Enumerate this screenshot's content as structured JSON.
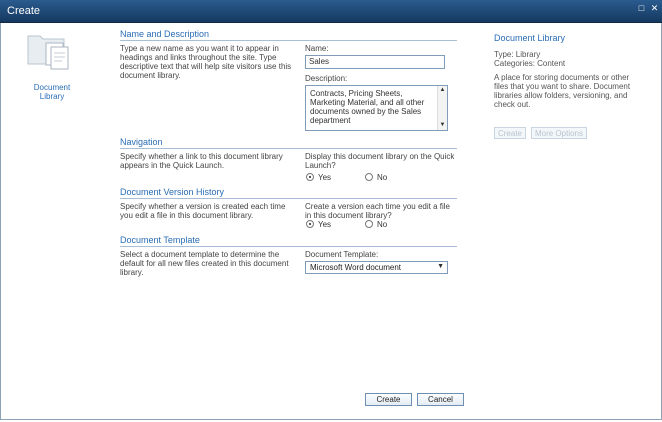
{
  "window": {
    "title": "Create"
  },
  "template": {
    "label": "Document Library"
  },
  "sections": {
    "name": {
      "title": "Name and Description",
      "description": "Type a new name as you want it to appear in headings and links throughout the site. Type descriptive text that will help site visitors use this document library.",
      "name_label": "Name:",
      "name_value": "Sales",
      "description_label": "Description:",
      "description_value": "Contracts, Pricing Sheets, Marketing Material, and all other documents owned by the Sales department"
    },
    "navigation": {
      "title": "Navigation",
      "description": "Specify whether a link to this document library appears in the Quick Launch.",
      "question": "Display this document library on the Quick Launch?",
      "yes": "Yes",
      "no": "No",
      "selected": "Yes"
    },
    "versioning": {
      "title": "Document Version History",
      "description": "Specify whether a version is created each time you edit a file in this document library.",
      "question": "Create a version each time you edit a file in this document library?",
      "yes": "Yes",
      "no": "No",
      "selected": "Yes"
    },
    "template": {
      "title": "Document Template",
      "description": "Select a document template to determine the default for all new files created in this document library.",
      "label": "Document Template:",
      "selected": "Microsoft Word document"
    }
  },
  "side_panel": {
    "title": "Document Library",
    "type": "Type: Library",
    "categories": "Categories: Content",
    "description": "A place for storing documents or other files that you want to share. Document libraries allow folders, versioning, and check out.",
    "create_label": "Create",
    "more_options_label": "More Options"
  },
  "footer": {
    "create_label": "Create",
    "cancel_label": "Cancel"
  },
  "colors": {
    "title_bar": "#1f4a75",
    "accent": "#2a6db5",
    "rule": "#a7bed6"
  }
}
